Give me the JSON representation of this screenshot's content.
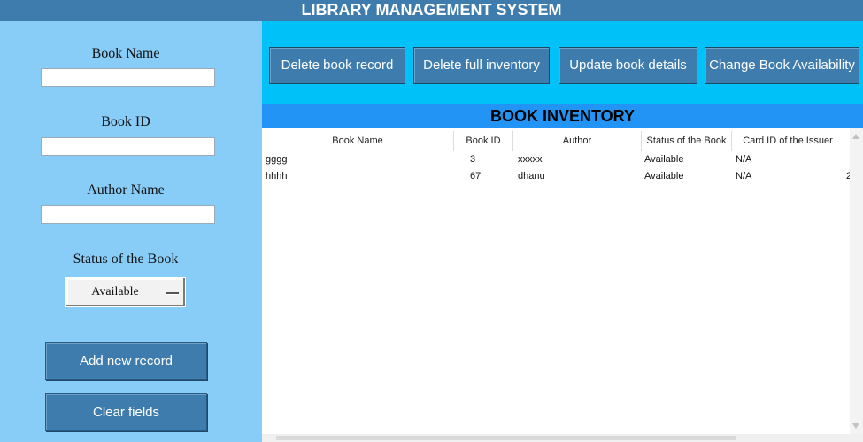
{
  "app": {
    "title": "LIBRARY MANAGEMENT SYSTEM"
  },
  "form": {
    "book_name_label": "Book Name",
    "book_name_value": "",
    "book_id_label": "Book ID",
    "book_id_value": "",
    "author_label": "Author Name",
    "author_value": "",
    "status_label": "Status of the Book",
    "status_value": "Available",
    "add_label": "Add new record",
    "clear_label": "Clear fields"
  },
  "toolbar": {
    "delete_record": "Delete book record",
    "delete_inventory": "Delete full inventory",
    "update_details": "Update book details",
    "change_availability": "Change Book Availability"
  },
  "inventory": {
    "title": "BOOK INVENTORY",
    "columns": [
      "Book Name",
      "Book ID",
      "Author",
      "Status of the Book",
      "Card ID of the Issuer"
    ],
    "rows": [
      [
        "gggg",
        "3",
        "xxxxx",
        "Available",
        "N/A"
      ],
      [
        "hhhh",
        "67",
        "dhanu",
        "Available",
        "N/A"
      ]
    ],
    "overflow_glyph": "2"
  },
  "colors": {
    "title_bg": "#3f7cae",
    "left_panel_bg": "#87cdf8",
    "toolbar_bg": "#00c2f9",
    "inventory_bar_bg": "#2294f5",
    "button_bg": "#3f7cae"
  }
}
